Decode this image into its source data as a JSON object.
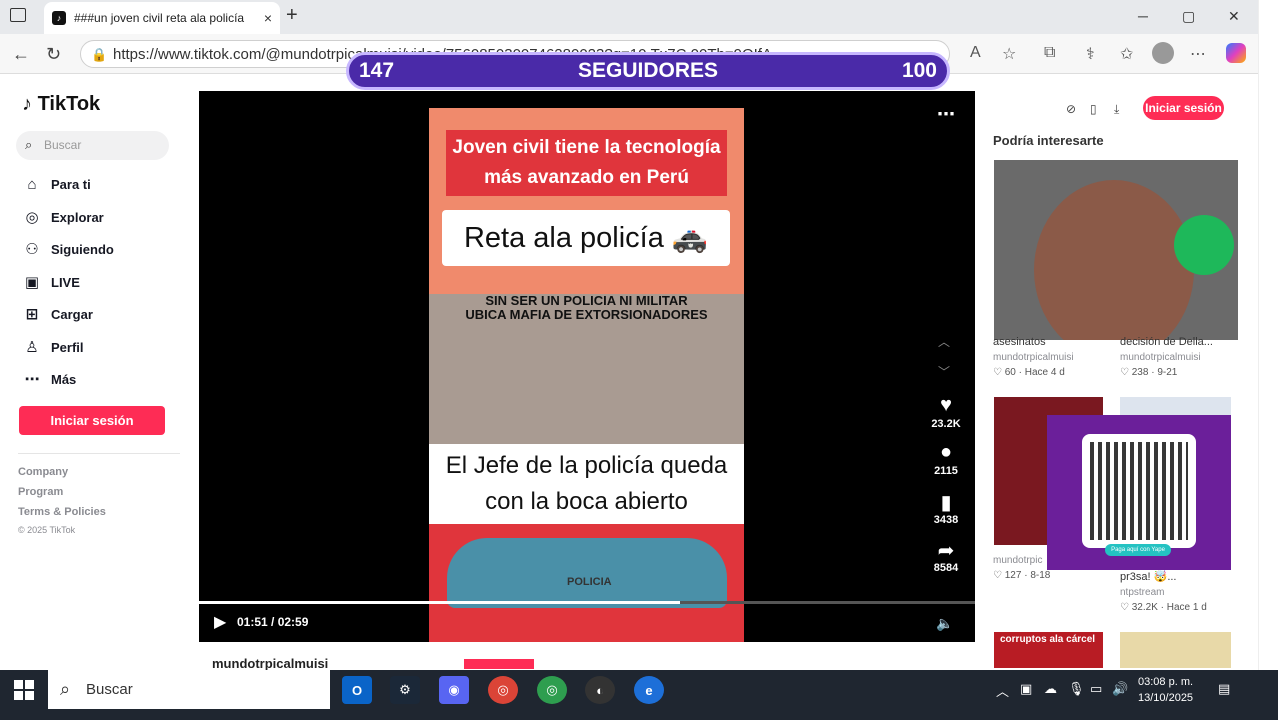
{
  "browser": {
    "tab_title": "###un joven civil reta ala policía",
    "url": "https://www.tiktok.com/@mundotrpicalmuisi/video/7560850300746280023?q=10.Tx7C.00Th=9QIfA",
    "tab_close": "×",
    "new_tab": "+",
    "window_min": "─",
    "window_max": "▢",
    "window_close": "✕"
  },
  "overlay": {
    "left_number": "147",
    "label": "SEGUIDORES",
    "right_number": "100"
  },
  "tiktok": {
    "logo": "TikTok",
    "search_placeholder": "Buscar",
    "nav": [
      {
        "label": "Para ti",
        "icon": "home-icon"
      },
      {
        "label": "Explorar",
        "icon": "compass-icon"
      },
      {
        "label": "Siguiendo",
        "icon": "following-icon"
      },
      {
        "label": "LIVE",
        "icon": "live-icon"
      },
      {
        "label": "Cargar",
        "icon": "upload-icon"
      },
      {
        "label": "Perfil",
        "icon": "profile-icon"
      },
      {
        "label": "Más",
        "icon": "more-icon"
      }
    ],
    "login_button": "Iniciar sesión",
    "footer": [
      "Company",
      "Program",
      "Terms & Policies"
    ],
    "copyright": "© 2025 TikTok"
  },
  "video": {
    "title_line1": "Joven civil tiene la tecnología",
    "title_line2": "más avanzado en Perú",
    "subtitle": "Reta ala policía 🚓",
    "caption_line1": "SIN SER UN POLICIA NI MILITAR",
    "caption_line2": "UBICA MAFIA DE EXTORSIONADORES",
    "quote_line1": "El Jefe de la policía queda",
    "quote_line2": "con la boca abierto",
    "car_label": "POLICIA",
    "time": "01:51 / 02:59",
    "progress": 0.62,
    "likes": "23.2K",
    "comments": "2115",
    "saves": "3438",
    "shares": "8584",
    "author": "mundotrpicalmuisi"
  },
  "right_panel": {
    "login_button": "Iniciar sesión",
    "section_title": "Podría interesarte",
    "cards": [
      {
        "title": "asesinatos",
        "author": "mundotrpicalmuisi",
        "stats": "♡ 60 · Hace 4 d"
      },
      {
        "title": "decisión de Della...",
        "author": "mundotrpicalmuisi",
        "stats": "♡ 238 · 9-21"
      },
      {
        "title": "",
        "author": "mundotrpic",
        "stats": "♡ 127 · 8-18"
      },
      {
        "title": "pr3sa! 🤯...",
        "author": "ntpstream",
        "stats": "♡ 32.2K · Hace 1 d"
      }
    ],
    "qr_tag": "Paga aquí con Yape",
    "bottom_tag": "corruptos ala cárcel"
  },
  "taskbar": {
    "search": "Buscar",
    "time": "03:08 p. m.",
    "date": "13/10/2025"
  }
}
